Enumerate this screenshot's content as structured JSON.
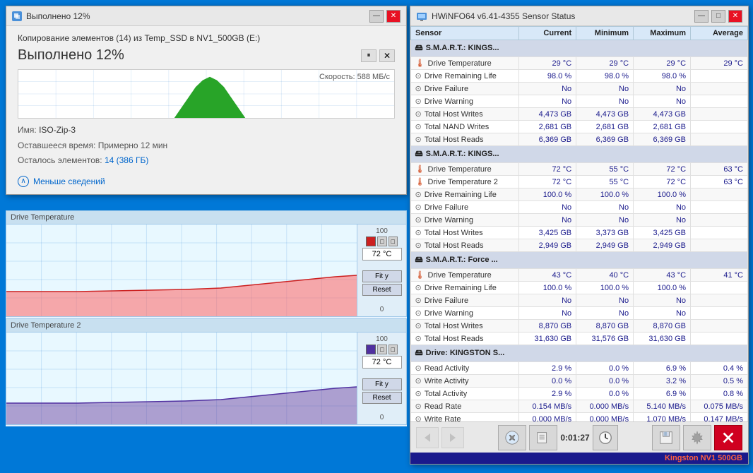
{
  "copy_dialog": {
    "title": "Выполнено 12%",
    "icon_label": "copy-icon",
    "path_text": "Копирование элементов (14) из Temp_SSD в NV1_500GB (E:)",
    "heading": "Выполнено 12%",
    "speed_label": "Скорость: 588 МБ/с",
    "name_label": "Имя:",
    "name_value": "ISO-Zip-3",
    "time_label": "Оставшееся время: Примерно 12 мин",
    "items_label": "Осталось элементов:",
    "items_value": "14 (386 ГБ)",
    "details_btn": "Меньше сведений"
  },
  "charts": [
    {
      "label": "Drive Temperature",
      "value": "72 °C",
      "max": "100",
      "min": "0"
    },
    {
      "label": "Drive Temperature 2",
      "value": "72 °C",
      "max": "100",
      "min": "0"
    }
  ],
  "hwinfo": {
    "title": "HWiNFO64 v6.41-4355 Sensor Status",
    "columns": [
      "Sensor",
      "Current",
      "Minimum",
      "Maximum",
      "Average"
    ],
    "groups": [
      {
        "header": "S.M.A.R.T.: KINGS...",
        "rows": [
          {
            "icon": "temp",
            "name": "Drive Temperature",
            "current": "29 °C",
            "minimum": "29 °C",
            "maximum": "29 °C",
            "average": "29 °C"
          },
          {
            "icon": "circle",
            "name": "Drive Remaining Life",
            "current": "98.0 %",
            "minimum": "98.0 %",
            "maximum": "98.0 %",
            "average": ""
          },
          {
            "icon": "circle",
            "name": "Drive Failure",
            "current": "No",
            "minimum": "No",
            "maximum": "No",
            "average": ""
          },
          {
            "icon": "circle",
            "name": "Drive Warning",
            "current": "No",
            "minimum": "No",
            "maximum": "No",
            "average": ""
          },
          {
            "icon": "circle",
            "name": "Total Host Writes",
            "current": "4,473 GB",
            "minimum": "4,473 GB",
            "maximum": "4,473 GB",
            "average": ""
          },
          {
            "icon": "circle",
            "name": "Total NAND Writes",
            "current": "2,681 GB",
            "minimum": "2,681 GB",
            "maximum": "2,681 GB",
            "average": ""
          },
          {
            "icon": "circle",
            "name": "Total Host Reads",
            "current": "6,369 GB",
            "minimum": "6,369 GB",
            "maximum": "6,369 GB",
            "average": ""
          }
        ]
      },
      {
        "header": "S.M.A.R.T.: KINGS...",
        "rows": [
          {
            "icon": "temp",
            "name": "Drive Temperature",
            "current": "72 °C",
            "minimum": "55 °C",
            "maximum": "72 °C",
            "average": "63 °C"
          },
          {
            "icon": "temp",
            "name": "Drive Temperature 2",
            "current": "72 °C",
            "minimum": "55 °C",
            "maximum": "72 °C",
            "average": "63 °C"
          },
          {
            "icon": "circle",
            "name": "Drive Remaining Life",
            "current": "100.0 %",
            "minimum": "100.0 %",
            "maximum": "100.0 %",
            "average": ""
          },
          {
            "icon": "circle",
            "name": "Drive Failure",
            "current": "No",
            "minimum": "No",
            "maximum": "No",
            "average": ""
          },
          {
            "icon": "circle",
            "name": "Drive Warning",
            "current": "No",
            "minimum": "No",
            "maximum": "No",
            "average": ""
          },
          {
            "icon": "circle",
            "name": "Total Host Writes",
            "current": "3,425 GB",
            "minimum": "3,373 GB",
            "maximum": "3,425 GB",
            "average": ""
          },
          {
            "icon": "circle",
            "name": "Total Host Reads",
            "current": "2,949 GB",
            "minimum": "2,949 GB",
            "maximum": "2,949 GB",
            "average": ""
          }
        ]
      },
      {
        "header": "S.M.A.R.T.: Force ...",
        "rows": [
          {
            "icon": "temp",
            "name": "Drive Temperature",
            "current": "43 °C",
            "minimum": "40 °C",
            "maximum": "43 °C",
            "average": "41 °C"
          },
          {
            "icon": "circle",
            "name": "Drive Remaining Life",
            "current": "100.0 %",
            "minimum": "100.0 %",
            "maximum": "100.0 %",
            "average": ""
          },
          {
            "icon": "circle",
            "name": "Drive Failure",
            "current": "No",
            "minimum": "No",
            "maximum": "No",
            "average": ""
          },
          {
            "icon": "circle",
            "name": "Drive Warning",
            "current": "No",
            "minimum": "No",
            "maximum": "No",
            "average": ""
          },
          {
            "icon": "circle",
            "name": "Total Host Writes",
            "current": "8,870 GB",
            "minimum": "8,870 GB",
            "maximum": "8,870 GB",
            "average": ""
          },
          {
            "icon": "circle",
            "name": "Total Host Reads",
            "current": "31,630 GB",
            "minimum": "31,576 GB",
            "maximum": "31,630 GB",
            "average": ""
          }
        ]
      },
      {
        "header": "Drive: KINGSTON S...",
        "rows": [
          {
            "icon": "circle",
            "name": "Read Activity",
            "current": "2.9 %",
            "minimum": "0.0 %",
            "maximum": "6.9 %",
            "average": "0.4 %"
          },
          {
            "icon": "circle",
            "name": "Write Activity",
            "current": "0.0 %",
            "minimum": "0.0 %",
            "maximum": "3.2 %",
            "average": "0.5 %"
          },
          {
            "icon": "circle",
            "name": "Total Activity",
            "current": "2.9 %",
            "minimum": "0.0 %",
            "maximum": "6.9 %",
            "average": "0.8 %"
          },
          {
            "icon": "circle",
            "name": "Read Rate",
            "current": "0.154 MB/s",
            "minimum": "0.000 MB/s",
            "maximum": "5.140 MB/s",
            "average": "0.075 MB/s"
          },
          {
            "icon": "circle",
            "name": "Write Rate",
            "current": "0.000 MB/s",
            "minimum": "0.000 MB/s",
            "maximum": "1.070 MB/s",
            "average": "0.147 MB/s"
          }
        ]
      }
    ],
    "toolbar": {
      "back_btn": "◀",
      "forward_btn": "▶",
      "time": "0:01:27",
      "status_text": "Kingston NV1 500GB"
    }
  }
}
